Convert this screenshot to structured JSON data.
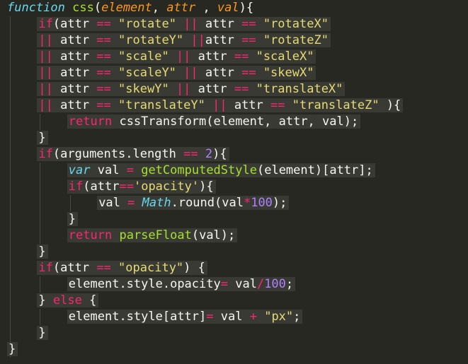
{
  "editor": {
    "language": "javascript",
    "theme": "monokai",
    "colors": {
      "background": "#272822",
      "keyword": "#f92672",
      "function": "#a6e22e",
      "string": "#e6db74",
      "number": "#ae81ff",
      "storage": "#66d9ef",
      "parameter": "#fd971f",
      "plain": "#f8f8f2"
    },
    "lines": [
      [
        [
          "storage",
          "function"
        ],
        [
          "plain",
          " "
        ],
        [
          "fn",
          "css"
        ],
        [
          "punct",
          "("
        ],
        [
          "param",
          "element"
        ],
        [
          "punct",
          ", "
        ],
        [
          "param",
          "attr"
        ],
        [
          "punct",
          " , "
        ],
        [
          "param",
          "val"
        ],
        [
          "punct",
          "){"
        ]
      ],
      [
        [
          "kw",
          "if"
        ],
        [
          "punct",
          "("
        ],
        [
          "plain",
          "attr "
        ],
        [
          "op",
          "=="
        ],
        [
          "plain",
          " "
        ],
        [
          "str",
          "\"rotate\""
        ],
        [
          "plain",
          " "
        ],
        [
          "op",
          "||"
        ],
        [
          "plain",
          " attr "
        ],
        [
          "op",
          "=="
        ],
        [
          "plain",
          " "
        ],
        [
          "str",
          "\"rotateX\""
        ]
      ],
      [
        [
          "op",
          "||"
        ],
        [
          "plain",
          " attr "
        ],
        [
          "op",
          "=="
        ],
        [
          "plain",
          " "
        ],
        [
          "str",
          "\"rotateY\""
        ],
        [
          "plain",
          " "
        ],
        [
          "op",
          "||"
        ],
        [
          "plain",
          "attr "
        ],
        [
          "op",
          "=="
        ],
        [
          "plain",
          " "
        ],
        [
          "str",
          "\"rotateZ\""
        ]
      ],
      [
        [
          "op",
          "||"
        ],
        [
          "plain",
          " attr "
        ],
        [
          "op",
          "=="
        ],
        [
          "plain",
          " "
        ],
        [
          "str",
          "\"scale\""
        ],
        [
          "plain",
          " "
        ],
        [
          "op",
          "||"
        ],
        [
          "plain",
          " attr "
        ],
        [
          "op",
          "=="
        ],
        [
          "plain",
          " "
        ],
        [
          "str",
          "\"scaleX\""
        ]
      ],
      [
        [
          "op",
          "||"
        ],
        [
          "plain",
          " attr "
        ],
        [
          "op",
          "=="
        ],
        [
          "plain",
          " "
        ],
        [
          "str",
          "\"scaleY\""
        ],
        [
          "plain",
          " "
        ],
        [
          "op",
          "||"
        ],
        [
          "plain",
          " attr "
        ],
        [
          "op",
          "=="
        ],
        [
          "plain",
          " "
        ],
        [
          "str",
          "\"skewX\""
        ]
      ],
      [
        [
          "op",
          "||"
        ],
        [
          "plain",
          " attr "
        ],
        [
          "op",
          "=="
        ],
        [
          "plain",
          " "
        ],
        [
          "str",
          "\"skewY\""
        ],
        [
          "plain",
          " "
        ],
        [
          "op",
          "||"
        ],
        [
          "plain",
          " attr "
        ],
        [
          "op",
          "=="
        ],
        [
          "plain",
          " "
        ],
        [
          "str",
          "\"translateX\""
        ]
      ],
      [
        [
          "op",
          "||"
        ],
        [
          "plain",
          " attr "
        ],
        [
          "op",
          "=="
        ],
        [
          "plain",
          " "
        ],
        [
          "str",
          "\"translateY\""
        ],
        [
          "plain",
          " "
        ],
        [
          "op",
          "||"
        ],
        [
          "plain",
          " attr "
        ],
        [
          "op",
          "=="
        ],
        [
          "plain",
          " "
        ],
        [
          "str",
          "\"translateZ\""
        ],
        [
          "punct",
          " ){"
        ]
      ],
      [
        [
          "kw",
          "return"
        ],
        [
          "plain",
          " cssTransform(element, attr, val);"
        ]
      ],
      [
        [
          "punct",
          "}"
        ]
      ],
      [
        [
          "kw",
          "if"
        ],
        [
          "punct",
          "("
        ],
        [
          "plain",
          "arguments.length "
        ],
        [
          "op",
          "=="
        ],
        [
          "plain",
          " "
        ],
        [
          "num",
          "2"
        ],
        [
          "punct",
          "){"
        ]
      ],
      [
        [
          "storage",
          "var"
        ],
        [
          "plain",
          " val "
        ],
        [
          "op",
          "="
        ],
        [
          "plain",
          " "
        ],
        [
          "fn",
          "getComputedStyle"
        ],
        [
          "punct",
          "("
        ],
        [
          "plain",
          "element)[attr];"
        ]
      ],
      [
        [
          "kw",
          "if"
        ],
        [
          "punct",
          "("
        ],
        [
          "plain",
          "attr"
        ],
        [
          "op",
          "=="
        ],
        [
          "str",
          "'opacity'"
        ],
        [
          "punct",
          "){"
        ]
      ],
      [
        [
          "plain",
          "val "
        ],
        [
          "op",
          "="
        ],
        [
          "plain",
          " "
        ],
        [
          "storage",
          "Math"
        ],
        [
          "plain",
          ".round(val"
        ],
        [
          "op",
          "*"
        ],
        [
          "num",
          "100"
        ],
        [
          "punct",
          ");"
        ]
      ],
      [
        [
          "punct",
          "}"
        ]
      ],
      [
        [
          "kw",
          "return"
        ],
        [
          "plain",
          " "
        ],
        [
          "fn",
          "parseFloat"
        ],
        [
          "punct",
          "("
        ],
        [
          "plain",
          "val);"
        ]
      ],
      [
        [
          "punct",
          "}"
        ]
      ],
      [
        [
          "kw",
          "if"
        ],
        [
          "punct",
          "("
        ],
        [
          "plain",
          "attr "
        ],
        [
          "op",
          "=="
        ],
        [
          "plain",
          " "
        ],
        [
          "str",
          "\"opacity\""
        ],
        [
          "punct",
          ") {"
        ]
      ],
      [
        [
          "plain",
          "element.style.opacity"
        ],
        [
          "op",
          "="
        ],
        [
          "plain",
          " val"
        ],
        [
          "op",
          "/"
        ],
        [
          "num",
          "100"
        ],
        [
          "punct",
          ";"
        ]
      ],
      [
        [
          "punct",
          "} "
        ],
        [
          "kw",
          "else"
        ],
        [
          "punct",
          " {"
        ]
      ],
      [
        [
          "plain",
          "element.style[attr]"
        ],
        [
          "op",
          "="
        ],
        [
          "plain",
          " val "
        ],
        [
          "op",
          "+"
        ],
        [
          "plain",
          " "
        ],
        [
          "str",
          "\"px\""
        ],
        [
          "punct",
          ";"
        ]
      ],
      [
        [
          "punct",
          "}"
        ]
      ],
      [
        [
          "punct",
          "}"
        ]
      ]
    ]
  }
}
